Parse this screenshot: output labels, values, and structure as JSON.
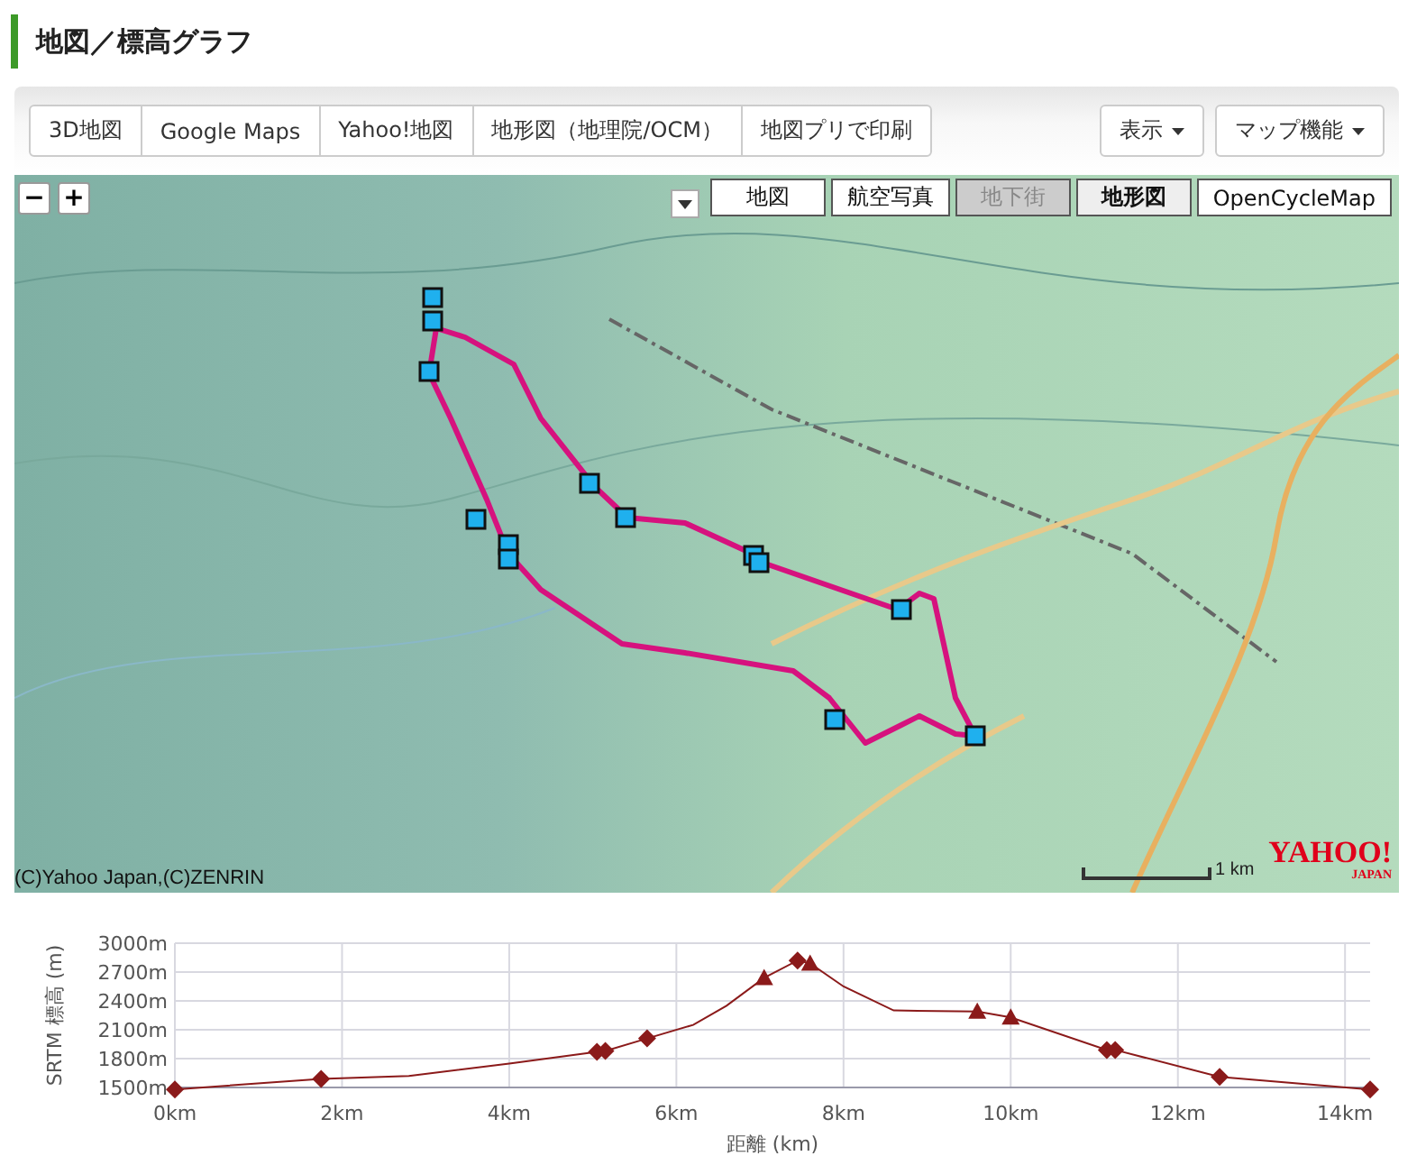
{
  "section_title": "地図／標高グラフ",
  "toolbar": {
    "links": [
      {
        "label": "3D地図"
      },
      {
        "label": "Google Maps"
      },
      {
        "label": "Yahoo!地図"
      },
      {
        "label": "地形図（地理院/OCM）"
      },
      {
        "label": "地図プリで印刷"
      }
    ],
    "menus": [
      {
        "label": "表示"
      },
      {
        "label": "マップ機能"
      }
    ]
  },
  "map": {
    "zoom_buttons": [
      "−",
      "+"
    ],
    "layers": [
      {
        "label": "地図",
        "selected": false,
        "disabled": false
      },
      {
        "label": "航空写真",
        "selected": false,
        "disabled": false
      },
      {
        "label": "地下街",
        "selected": false,
        "disabled": true
      },
      {
        "label": "地形図",
        "selected": true,
        "disabled": false
      },
      {
        "label": "OpenCycleMap",
        "selected": false,
        "disabled": false
      }
    ],
    "copyright": "(C)Yahoo Japan,(C)ZENRIN",
    "scale_label": "1 km",
    "logo": "YAHOO!",
    "logo_sub": "JAPAN"
  },
  "profile": {
    "chart_data": {
      "type": "line",
      "xlabel": "距離 (km)",
      "ylabel": "SRTM 標高 (m)",
      "x": [
        0,
        1.75,
        2.8,
        4,
        5.05,
        5.15,
        5.65,
        6.2,
        6.6,
        7.05,
        7.45,
        7.6,
        8,
        8.6,
        9.6,
        10,
        11.15,
        11.25,
        12.5,
        14.3
      ],
      "series": [
        {
          "type": "line",
          "color": "#8b1a1a",
          "values": [
            1480,
            1590,
            1620,
            1750,
            1870,
            1880,
            2010,
            2150,
            2350,
            2640,
            2820,
            2790,
            2550,
            2300,
            2290,
            2230,
            1890,
            1890,
            1610,
            1480
          ]
        },
        {
          "type": "scatter",
          "marker": "diamond",
          "color": "#8b1a1a",
          "values": [
            1480,
            1590,
            null,
            null,
            1870,
            1880,
            2010,
            null,
            null,
            null,
            2820,
            null,
            null,
            null,
            null,
            null,
            1890,
            1890,
            1610,
            1480
          ]
        },
        {
          "type": "scatter",
          "marker": "triangle",
          "color": "#8b1a1a",
          "values": [
            null,
            null,
            null,
            null,
            null,
            null,
            null,
            null,
            null,
            2640,
            null,
            2790,
            null,
            null,
            2290,
            2230,
            null,
            null,
            null,
            null
          ]
        }
      ],
      "xlim": [
        0,
        14.3
      ],
      "ylim": [
        1450,
        3000
      ],
      "grid": true,
      "xticks": [
        {
          "value": 0,
          "label": "0km"
        },
        {
          "value": 2,
          "label": "2km"
        },
        {
          "value": 4,
          "label": "4km"
        },
        {
          "value": 6,
          "label": "6km"
        },
        {
          "value": 8,
          "label": "8km"
        },
        {
          "value": 10,
          "label": "10km"
        },
        {
          "value": 12,
          "label": "12km"
        },
        {
          "value": 14,
          "label": "14km"
        }
      ],
      "yticks": [
        {
          "value": 1500,
          "label": "1500m"
        },
        {
          "value": 1800,
          "label": "1800m"
        },
        {
          "value": 2100,
          "label": "2100m"
        },
        {
          "value": 2400,
          "label": "2400m"
        },
        {
          "value": 2700,
          "label": "2700m"
        },
        {
          "value": 3000,
          "label": "3000m"
        }
      ]
    }
  }
}
